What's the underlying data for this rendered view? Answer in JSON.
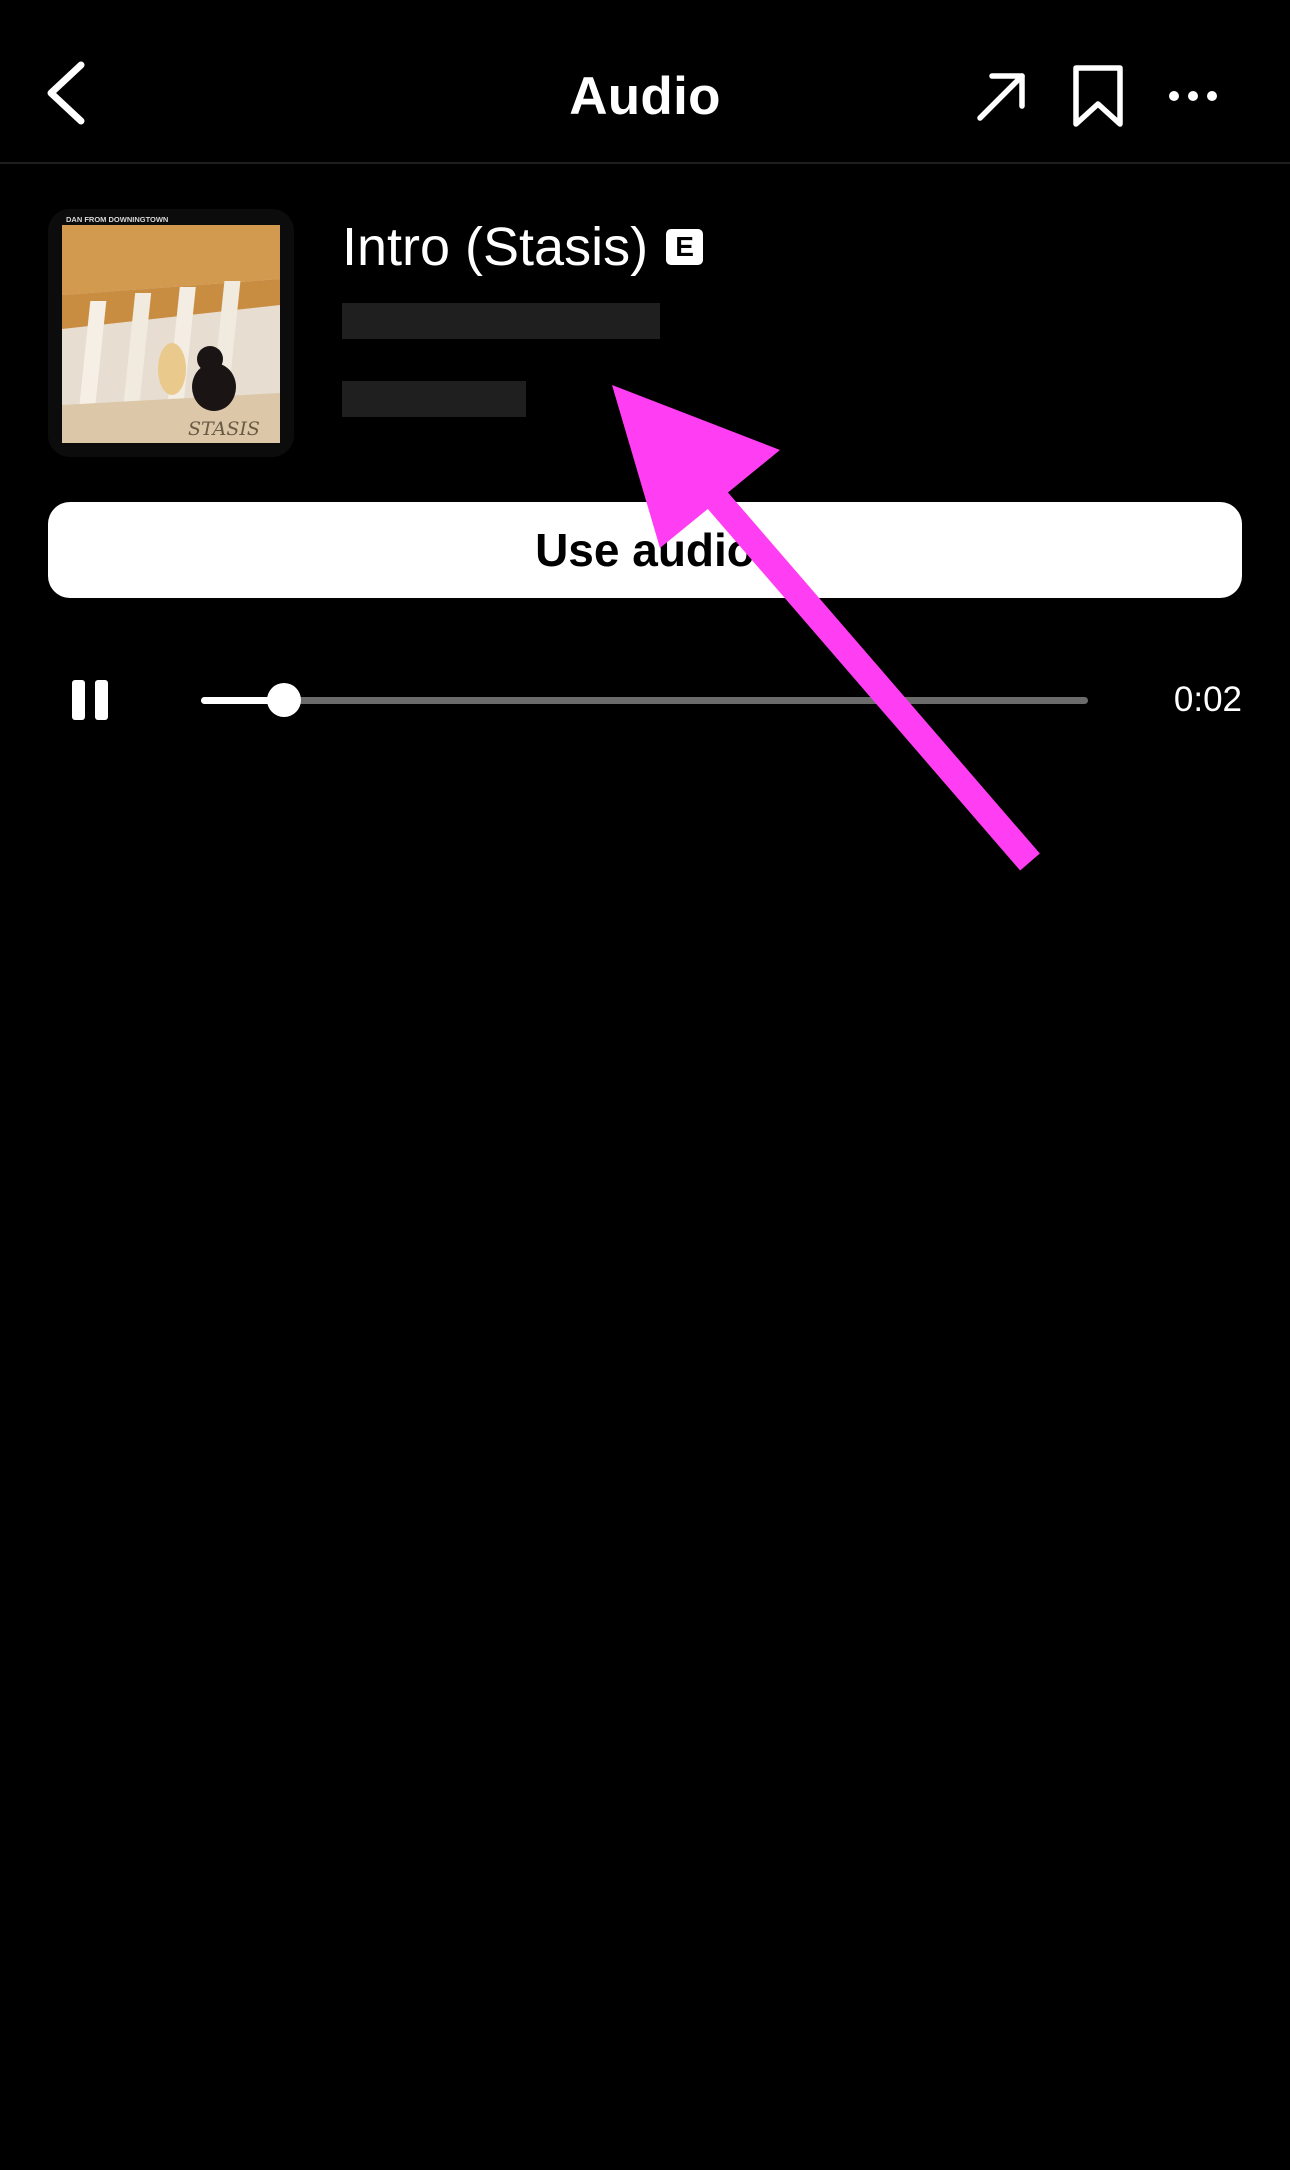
{
  "header": {
    "title": "Audio",
    "icons": {
      "back": "chevron-left-icon",
      "share": "arrow-up-right-icon",
      "save": "bookmark-icon",
      "more": "ellipsis-icon"
    }
  },
  "track": {
    "title": "Intro (Stasis)",
    "explicit_badge": "E",
    "album_art": {
      "top_text": "DAN FROM DOWNINGTOWN",
      "bottom_text": "STASIS"
    }
  },
  "actions": {
    "use_audio_label": "Use audio"
  },
  "player": {
    "time": "0:02",
    "progress_fraction": 0.094,
    "state": "playing"
  },
  "annotation": {
    "color": "#ff3df2"
  }
}
